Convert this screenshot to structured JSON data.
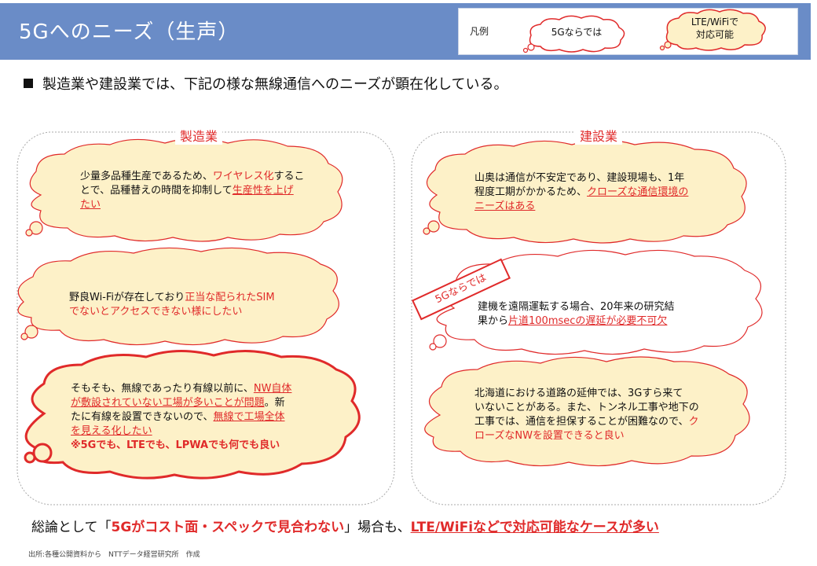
{
  "header": {
    "title": "5Gへのニーズ（生声）"
  },
  "legend": {
    "title": "凡例",
    "items": [
      {
        "label": "5Gならでは",
        "style": "white-cloud-red-outline"
      },
      {
        "label_line1": "LTE/WiFiで",
        "label_line2": "対応可能",
        "style": "cream-cloud-red-outline"
      }
    ]
  },
  "intro": "製造業や建設業では、下記の様な無線通信へのニーズが顕在化している。",
  "groups": {
    "manufacturing": {
      "label": "製造業",
      "clouds": [
        {
          "text_a": "少量多品種生産であるため、",
          "hl_1": "ワイヤレス化",
          "text_b": "するこ",
          "text_c": "とで、品種替えの時間を抑制して",
          "hl_2": "生産性を上げ",
          "hl_3": "たい"
        },
        {
          "text_a": "野良Wi-Fiが存在しており",
          "hl_1": "正当な配られたSIM",
          "hl_2": "でないとアクセスできない様にしたい"
        },
        {
          "text_a": "そもそも、無線であったり有線以前に、",
          "hl_1": "NW自体",
          "hl_2": "が敷設されていない工場が多いことが問題",
          "text_b": "。新",
          "text_c": "たに有線を設置できないので、",
          "hl_3": "無線で工場全体",
          "hl_4": "を見える化したい",
          "note": "※5Gでも、LTEでも、LPWAでも何でも良い"
        }
      ]
    },
    "construction": {
      "label": "建設業",
      "clouds": [
        {
          "text_a": "山奥は通信が不安定であり、建設現場も、1年",
          "text_b": "程度工期がかかるため、",
          "hl_1": "クローズな通信環境の",
          "hl_2": "ニーズはある"
        },
        {
          "text_a": "建機を遠隔運転する場合、20年来の研究結",
          "text_b": "果から",
          "hl_1": "片道100msecの遅延が必要不可欠",
          "tag": "5Gならでは"
        },
        {
          "text_a": "北海道における道路の延伸では、3Gすら来て",
          "text_b": "いないことがある。また、トンネル工事や地下の",
          "text_c": "工事では、通信を担保することが困難なので、",
          "hl_1": "ク",
          "hl_2": "ローズなNWを設置できると良い"
        }
      ]
    }
  },
  "conclusion": {
    "pre": "総論として「",
    "highlight_1": "5Gがコスト面・スペックで見合わない",
    "mid": "」場合も、",
    "highlight_2": "LTE/WiFiなどで対応可能なケースが多い"
  },
  "source": "出所:各種公開資料から　NTTデータ経営研究所　作成",
  "colors": {
    "header_bg": "#6a8cc7",
    "accent_red": "#e02a2a",
    "cloud_cream": "#fdf1c8",
    "group_border": "#aaaaaa"
  }
}
